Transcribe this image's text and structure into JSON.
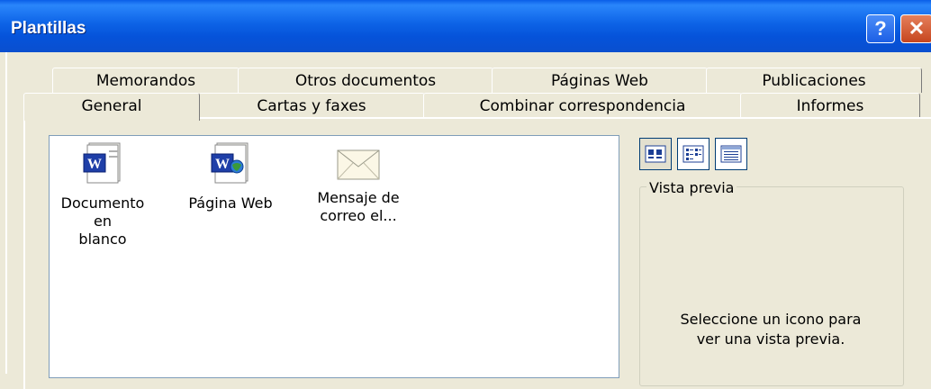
{
  "window": {
    "title": "Plantillas",
    "help_glyph": "?",
    "close_glyph": "✕"
  },
  "tabs": {
    "top_row": [
      "Memorandos",
      "Otros documentos",
      "Páginas Web",
      "Publicaciones"
    ],
    "bottom_row": [
      "General",
      "Cartas y faxes",
      "Combinar correspondencia",
      "Informes"
    ],
    "selected": "General"
  },
  "templates": [
    {
      "label": "Documento en\nblanco",
      "icon": "word-document-icon"
    },
    {
      "label": "Página Web",
      "icon": "word-web-page-icon"
    },
    {
      "label": "Mensaje de\ncorreo el...",
      "icon": "envelope-icon"
    }
  ],
  "view_buttons": [
    "large-icons-view-icon",
    "list-view-icon",
    "details-view-icon"
  ],
  "preview": {
    "legend": "Vista previa",
    "message": "Seleccione un icono para\nver una vista previa."
  }
}
